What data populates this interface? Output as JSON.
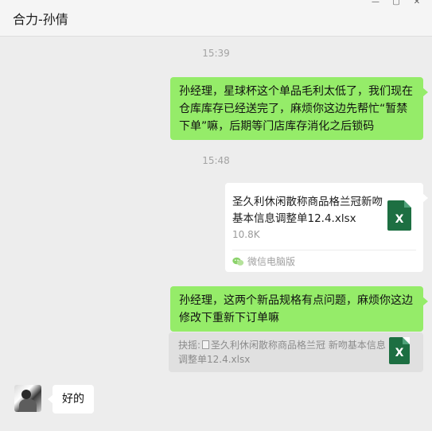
{
  "header": {
    "title": "合力-孙倩"
  },
  "messages": {
    "time1": "15:39",
    "msg1": "孙经理，星球杯这个单品毛利太低了，我们现在仓库库存已经送完了，麻烦你这边先帮忙“暂禁下单”嘛，后期等门店库存消化之后锁码",
    "time2": "15:48",
    "file": {
      "name": "圣久利休闲散称商品格兰冠新吻基本信息调整单12.4.xlsx",
      "size": "10.8K",
      "source": "微信电脑版",
      "icon_letter": "X",
      "icon_color": "#1d6f42"
    },
    "msg2": "孙经理，这两个新品规格有点问题，麻烦你这边修改下重新下订单嘛",
    "quote": {
      "prefix": "抉摇:",
      "text": "圣久利休闲散称商品格兰冠 新吻基本信息调整单12.4.xlsx",
      "icon_letter": "X"
    },
    "reply": "好的"
  },
  "colors": {
    "my_bubble": "#95ec69",
    "their_bubble": "#ffffff",
    "background": "#ededed"
  }
}
